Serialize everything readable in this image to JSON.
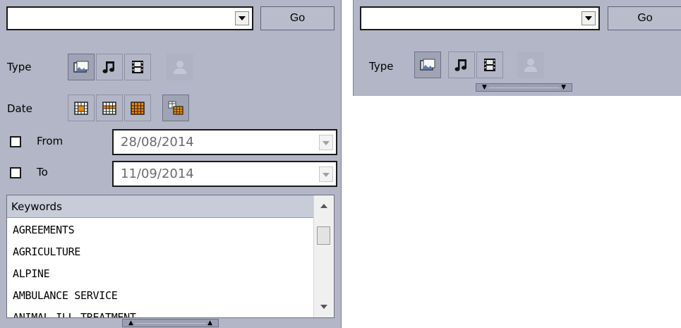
{
  "left_panel": {
    "search_value": "",
    "go_label": "Go",
    "type_label": "Type",
    "date_label": "Date",
    "type_buttons": [
      "image-icon",
      "music-note-icon",
      "film-icon",
      "person-icon"
    ],
    "date_buttons": [
      "calendar-day-icon",
      "calendar-week-icon",
      "calendar-month-icon",
      "calendar-range-icon"
    ],
    "from_label": "From",
    "to_label": "To",
    "from_value": "28/08/2014",
    "to_value": "11/09/2014",
    "keywords_header": "Keywords",
    "keywords": [
      "AGREEMENTS",
      "AGRICULTURE",
      "ALPINE",
      "AMBULANCE SERVICE",
      "ANIMAL ILL TREATMENT"
    ],
    "collapse_icon": "collapse-up-icon"
  },
  "right_panel": {
    "search_value": "",
    "go_label": "Go",
    "type_label": "Type",
    "type_buttons": [
      "image-icon",
      "music-note-icon",
      "film-icon",
      "person-icon"
    ],
    "expand_icon": "expand-down-icon"
  },
  "colors": {
    "panel_bg": "#b2b6c7",
    "selected_button": "#9ea3b6",
    "calendar_accent": "#f08a00"
  }
}
